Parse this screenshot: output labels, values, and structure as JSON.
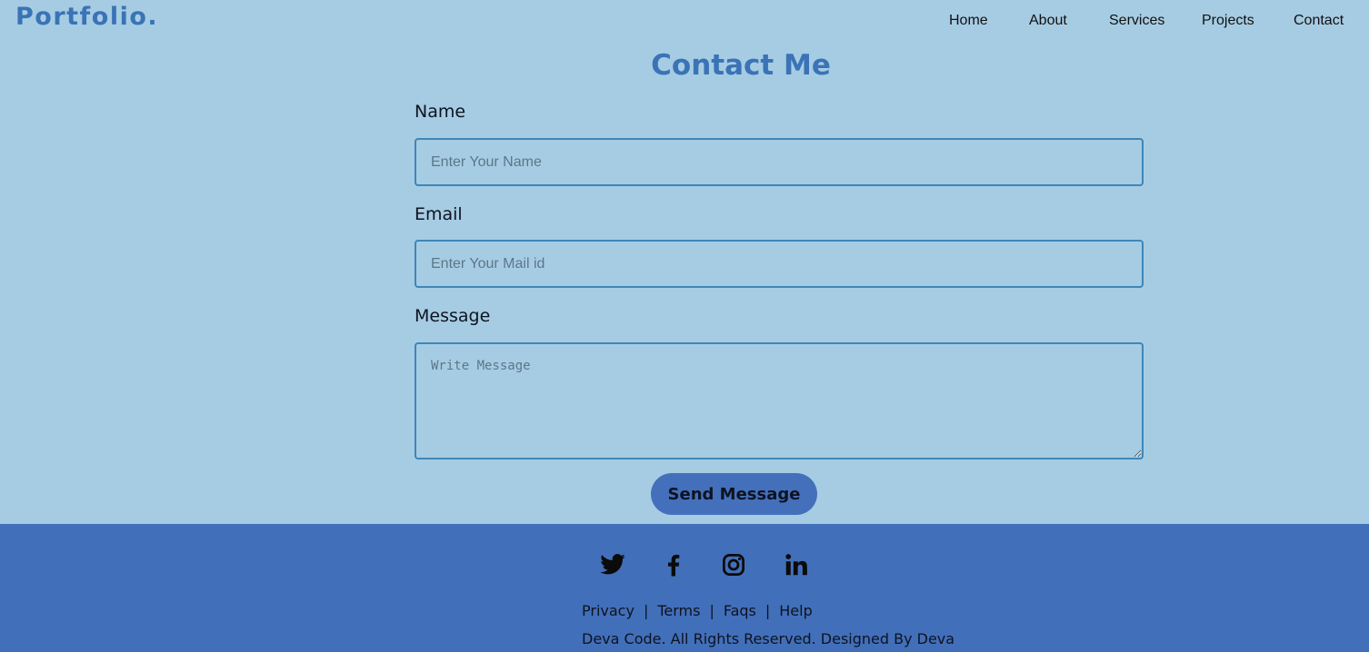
{
  "header": {
    "logo": "Portfolio.",
    "nav": {
      "home": "Home",
      "about": "About",
      "services": "Services",
      "projects": "Projects",
      "contact": "Contact"
    }
  },
  "contact": {
    "title": "Contact Me",
    "name": {
      "label": "Name",
      "placeholder": "Enter Your Name",
      "value": ""
    },
    "email": {
      "label": "Email",
      "placeholder": "Enter Your Mail id",
      "value": ""
    },
    "message": {
      "label": "Message",
      "placeholder": "Write Message",
      "value": ""
    },
    "send_label": "Send Message"
  },
  "footer": {
    "social_icons": [
      "twitter-icon",
      "facebook-icon",
      "instagram-icon",
      "linkedin-icon"
    ],
    "links": {
      "privacy": "Privacy",
      "terms": "Terms",
      "faqs": "Faqs",
      "help": "Help",
      "separator": "|"
    },
    "copyright": "Deva Code. All Rights Reserved. Designed By Deva"
  },
  "colors": {
    "background": "#a6cce3",
    "accent": "#3a73b6",
    "footer": "#426fb9",
    "button": "#4470bb",
    "input_border": "#3f86b8"
  }
}
